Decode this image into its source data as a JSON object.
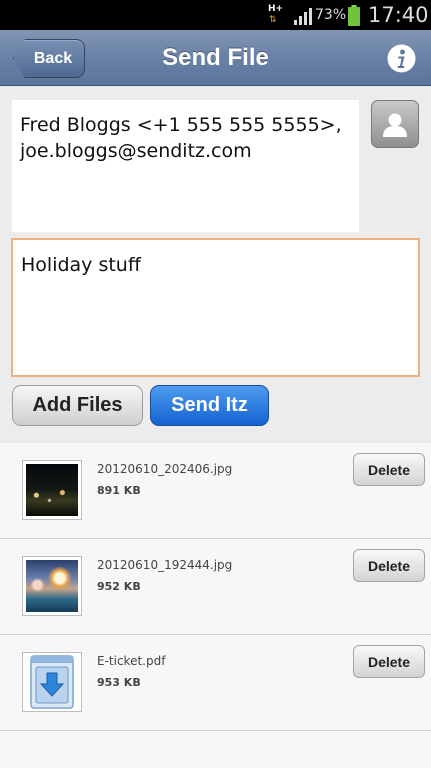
{
  "status_bar": {
    "network": "H+",
    "battery_percent": "73%",
    "time": "17:40"
  },
  "header": {
    "back_label": "Back",
    "title": "Send File",
    "info_icon": "info-icon"
  },
  "recipients": {
    "text": "Fred Bloggs <+1 555 555 5555>, joe.bloggs@senditz.com",
    "contact_icon": "contact-icon"
  },
  "message": {
    "text": "Holiday stuff"
  },
  "actions": {
    "add_files_label": "Add Files",
    "send_label": "Send Itz"
  },
  "files": [
    {
      "name": "20120610_202406.jpg",
      "size": "891 KB",
      "delete_label": "Delete",
      "thumb": "photo-night"
    },
    {
      "name": "20120610_192444.jpg",
      "size": "952 KB",
      "delete_label": "Delete",
      "thumb": "photo-pool"
    },
    {
      "name": "E-ticket.pdf",
      "size": "953 KB",
      "delete_label": "Delete",
      "thumb": "pdf-download-icon"
    }
  ],
  "colors": {
    "header": "#6b83a7",
    "send_button": "#1d6fdc",
    "message_border": "#f0b07e",
    "battery": "#6fc43b"
  }
}
